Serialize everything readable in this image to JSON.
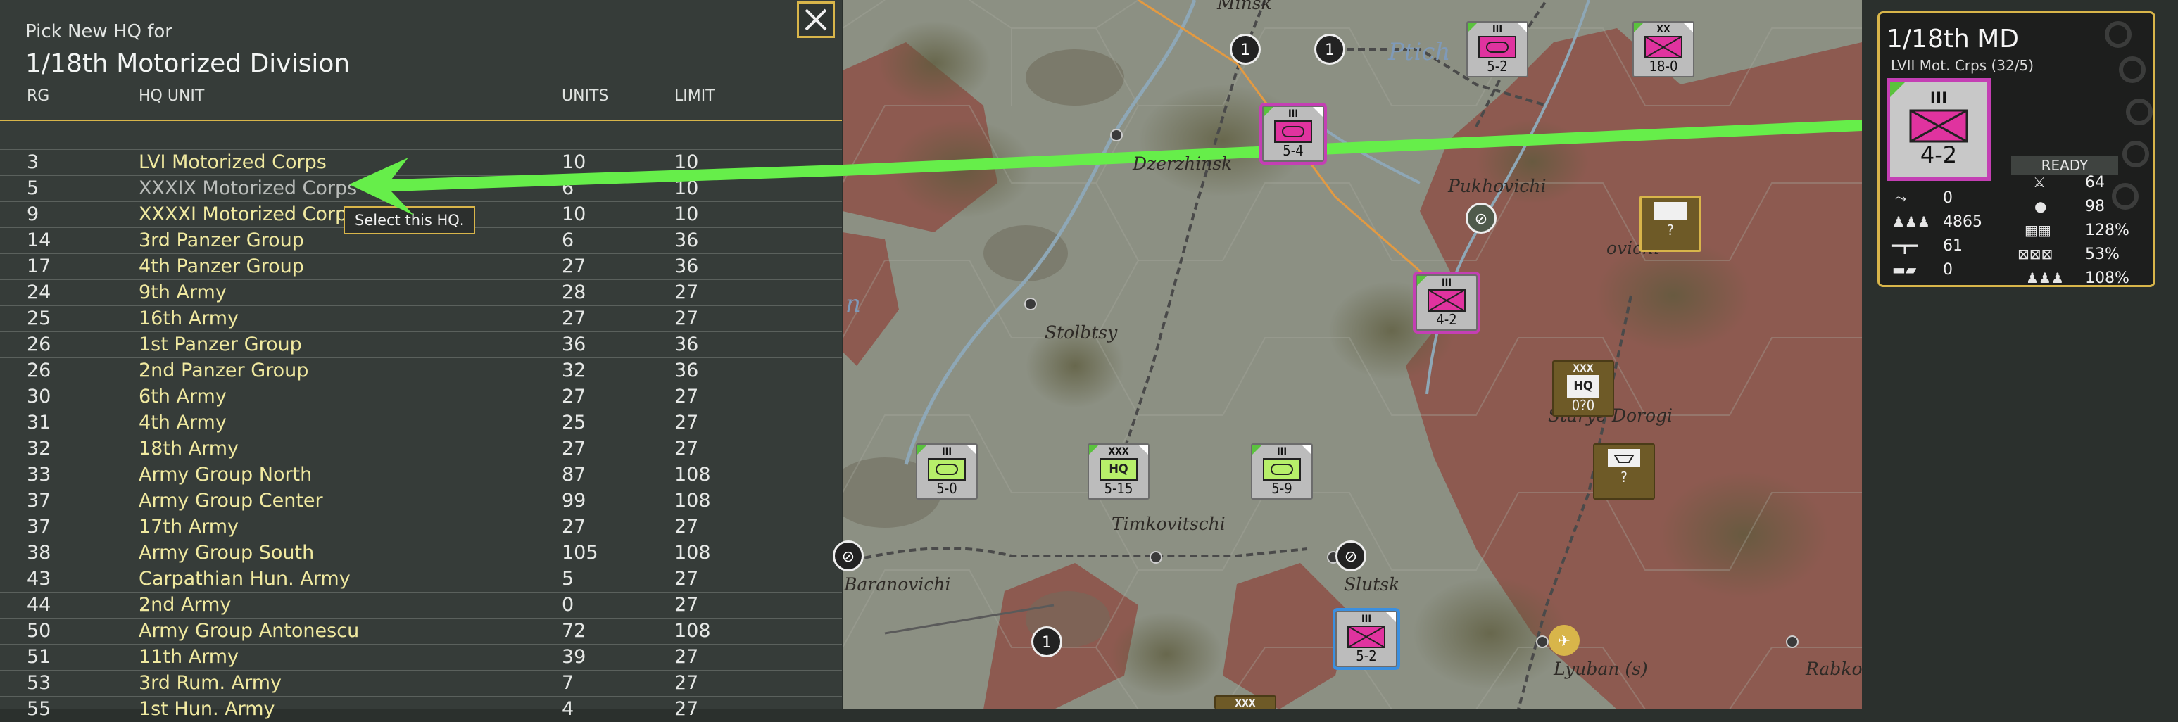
{
  "hq_picker": {
    "subtitle": "Pick New HQ for",
    "title": "1/18th Motorized Division",
    "columns": {
      "rg": "RG",
      "hq_unit": "HQ UNIT",
      "units": "UNITS",
      "limit": "LIMIT"
    },
    "tooltip": "Select this HQ.",
    "close_icon": "close-x-icon",
    "rows": [
      {
        "rg": "3",
        "name": "LVI Motorized Corps",
        "units": "10",
        "limit": "10"
      },
      {
        "rg": "5",
        "name": "XXXIX Motorized Corps",
        "units": "6",
        "limit": "10"
      },
      {
        "rg": "9",
        "name": "XXXXI Motorized Corps",
        "units": "10",
        "limit": "10"
      },
      {
        "rg": "14",
        "name": "3rd Panzer Group",
        "units": "6",
        "limit": "36"
      },
      {
        "rg": "17",
        "name": "4th Panzer Group",
        "units": "27",
        "limit": "36"
      },
      {
        "rg": "24",
        "name": "9th Army",
        "units": "28",
        "limit": "27"
      },
      {
        "rg": "25",
        "name": "16th Army",
        "units": "27",
        "limit": "27"
      },
      {
        "rg": "26",
        "name": "1st Panzer Group",
        "units": "36",
        "limit": "36"
      },
      {
        "rg": "26",
        "name": "2nd Panzer Group",
        "units": "32",
        "limit": "36"
      },
      {
        "rg": "30",
        "name": "6th Army",
        "units": "27",
        "limit": "27"
      },
      {
        "rg": "31",
        "name": "4th Army",
        "units": "25",
        "limit": "27"
      },
      {
        "rg": "32",
        "name": "18th Army",
        "units": "27",
        "limit": "27"
      },
      {
        "rg": "33",
        "name": "Army Group North",
        "units": "87",
        "limit": "108"
      },
      {
        "rg": "37",
        "name": "Army Group Center",
        "units": "99",
        "limit": "108"
      },
      {
        "rg": "37",
        "name": "17th Army",
        "units": "27",
        "limit": "27"
      },
      {
        "rg": "38",
        "name": "Army Group South",
        "units": "105",
        "limit": "108"
      },
      {
        "rg": "43",
        "name": "Carpathian Hun. Army",
        "units": "5",
        "limit": "27"
      },
      {
        "rg": "44",
        "name": "2nd Army",
        "units": "0",
        "limit": "27"
      },
      {
        "rg": "50",
        "name": "Army Group Antonescu",
        "units": "72",
        "limit": "108"
      },
      {
        "rg": "51",
        "name": "11th Army",
        "units": "39",
        "limit": "27"
      },
      {
        "rg": "53",
        "name": "3rd Rum. Army",
        "units": "7",
        "limit": "27"
      },
      {
        "rg": "55",
        "name": "1st Hun. Army",
        "units": "4",
        "limit": "27"
      }
    ]
  },
  "map": {
    "labels": {
      "minsk": "Minsk",
      "ptich": "Ptich",
      "dzerzhinsk": "Dzerzhinsk",
      "pukhovichi": "Pukhovichi",
      "ovichi": "ovichi",
      "stolbtsy": "Stolbtsy",
      "starye_dorogi": "Starye Dorogi",
      "timkovitschi": "Timkovitschi",
      "baranovichi": "Baranovichi",
      "slutsk": "Slutsk",
      "lyuban": "Lyuban (s)",
      "rabko": "Rabko",
      "water_n": "n"
    },
    "counters": {
      "c1": {
        "size": "III",
        "strength": "5-2"
      },
      "c2": {
        "size": "XX",
        "strength": "18-0"
      },
      "c3": {
        "size": "III",
        "strength": "5-4"
      },
      "c4": {
        "size": "",
        "strength": "?"
      },
      "c5": {
        "size": "III",
        "strength": "4-2"
      },
      "c6": {
        "size": "XXX",
        "hq": "HQ",
        "strength": "0?0"
      },
      "c7": {
        "size": "",
        "strength": "?"
      },
      "c8": {
        "size": "III",
        "strength": "5-0"
      },
      "c9": {
        "size": "XXX",
        "hq": "HQ",
        "strength": "5-15"
      },
      "c10": {
        "size": "III",
        "strength": "5-9"
      },
      "c11": {
        "size": "III",
        "strength": "5-2"
      },
      "c12": {
        "size": "XXX"
      }
    },
    "markers": {
      "m1": "1",
      "m2": "1",
      "m3": "1"
    },
    "colors": {
      "soviet_hex": "#8d5a50",
      "axis_hex": "#8c9083",
      "arrow": "#66ee4a",
      "mech_pink": "#e0339f",
      "mot_green": "#b7ef6a"
    }
  },
  "unit_card": {
    "title": "1/18th MD",
    "subtitle": "LVII Mot. Crps (32/5)",
    "counter_size": "III",
    "counter_strength": "4-2",
    "ready": "READY",
    "stats": {
      "moves": "0",
      "men": "4865",
      "guns": "61",
      "tanks": "0",
      "experience": "64",
      "supply": "98",
      "tooe": "128%",
      "fatigue": "53%",
      "morale": "108%"
    }
  }
}
